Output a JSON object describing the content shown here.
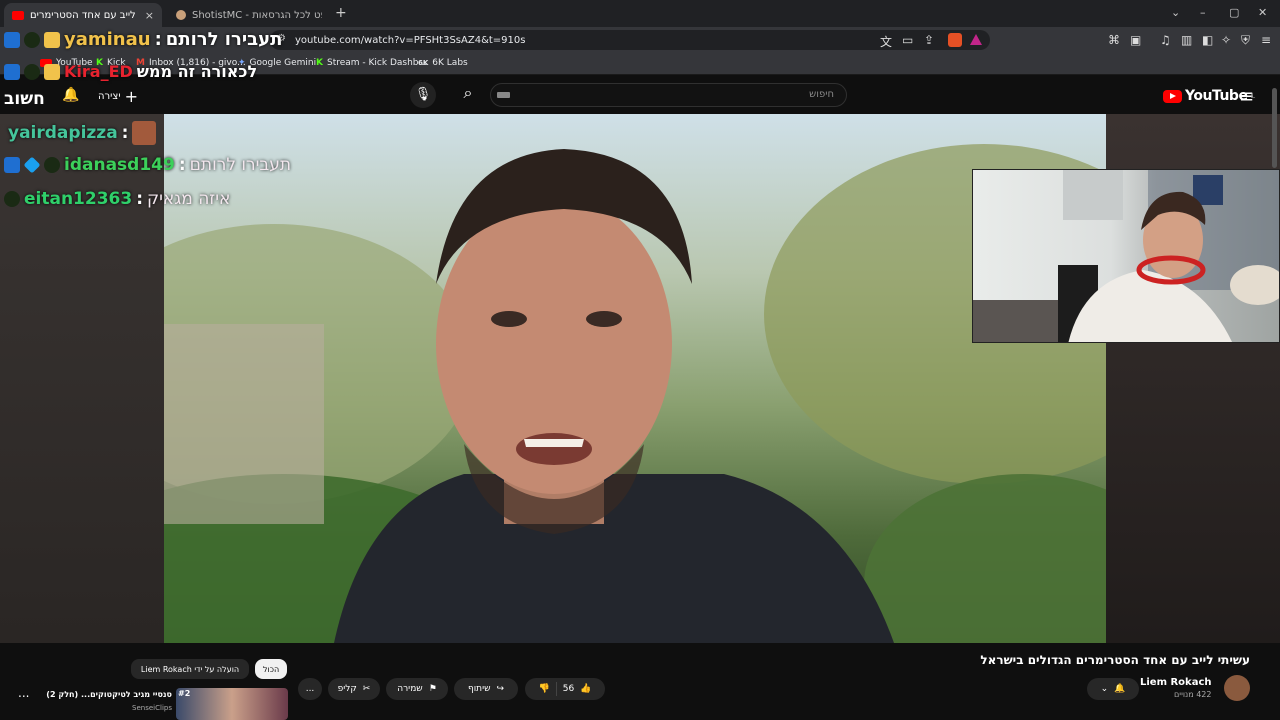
{
  "browser": {
    "tabs": [
      {
        "title": "עשיתי לייב עם אחד הסטרימרים",
        "close": "×",
        "active": true
      },
      {
        "title": "ShotistMC - מיינקראפט לכל הגרסאות",
        "active": false
      }
    ],
    "new_tab": "+",
    "window_controls": [
      "⌄",
      "–",
      "▢",
      "✕"
    ],
    "url": "youtube.com/watch?v=PFSHt3SsAZ4&t=910s",
    "bookmarks": [
      {
        "label": "YouTube",
        "icon": "youtube-icon"
      },
      {
        "label": "Kick",
        "icon": "kick-icon",
        "icon_text": "K"
      },
      {
        "label": "Inbox (1,816) - givo...",
        "icon": "gmail-icon",
        "icon_text": "M"
      },
      {
        "label": "Google Gemini",
        "icon": "gemini-icon",
        "icon_text": "✦"
      },
      {
        "label": "Stream - Kick Dashb...",
        "icon": "kick-icon",
        "icon_text": "K"
      },
      {
        "label": "6K Labs",
        "icon": "labs-icon",
        "icon_text": "6K"
      }
    ]
  },
  "youtube": {
    "logo_text": "YouTube",
    "logo_sup": "IL",
    "search_placeholder": "חיפוש",
    "create_label": "יצירה",
    "account_label": "חשוב"
  },
  "chat": [
    {
      "user": "yaminau",
      "sep": ":",
      "message": "תעבירו לרותם",
      "user_color": "#f1c24b",
      "msg_color": "#ffffff"
    },
    {
      "user": "Kira_ED",
      "sep": "",
      "message": "לכאורה זה ממש",
      "user_color": "#e8232f",
      "msg_color": "#ffffff"
    },
    {
      "user": "yairdapizza",
      "sep": ":",
      "message": "",
      "user_color": "#45c59b",
      "msg_color": "#ffffff"
    },
    {
      "user": "idanasd149",
      "sep": ":",
      "message": "תעבירו לרותם",
      "user_color": "#3cd05a",
      "msg_color": "#f3e7ee"
    },
    {
      "user": "eitan12363",
      "sep": ":",
      "message": "איזה מגאיק",
      "user_color": "#2fd06a",
      "msg_color": "#f3e7ee"
    }
  ],
  "video": {
    "title": "עשיתי לייב עם אחד הסטרימרים הגדולים בישראל",
    "channel": "Liem Rokach",
    "subscribers": "422 מנויים",
    "likes": "56",
    "share_label": "שיתוף",
    "save_label": "שמירה",
    "clip_label": "קליפ",
    "more": "..."
  },
  "recommendations": {
    "chips": [
      "הכול",
      "הועלה על ידי Liem Rokach"
    ],
    "item": {
      "rank": "#2",
      "title": "סנסיי מגיב לטיקטוקים... (חלק 2)",
      "channel": "SenseiClips"
    },
    "more": "..."
  },
  "colors": {
    "brand_red": "#ff0000",
    "chat_gold": "#f1c24b",
    "chat_green": "#3cd05a"
  }
}
